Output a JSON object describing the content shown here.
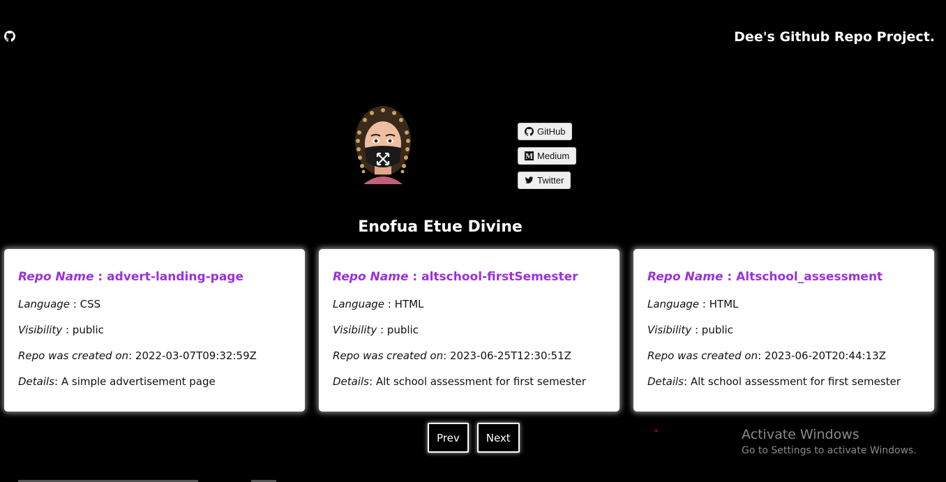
{
  "header": {
    "title": "Dee's Github Repo Project."
  },
  "social": [
    {
      "label": "GitHub",
      "icon": "github-icon"
    },
    {
      "label": "Medium",
      "icon": "medium-icon"
    },
    {
      "label": "Twitter",
      "icon": "twitter-icon"
    }
  ],
  "profile": {
    "name": "Enofua Etue Divine"
  },
  "labels": {
    "repo_name": "Repo Name",
    "language": "Language",
    "visibility": "Visibility",
    "created": "Repo was created on",
    "details": "Details"
  },
  "repos": [
    {
      "name": "advert-landing-page",
      "language": "CSS",
      "visibility": "public",
      "created": "2022-03-07T09:32:59Z",
      "details": "A simple advertisement page"
    },
    {
      "name": "altschool-firstSemester",
      "language": "HTML",
      "visibility": "public",
      "created": "2023-06-25T12:30:51Z",
      "details": "Alt school assessment for first semester"
    },
    {
      "name": "Altschool_assessment",
      "language": "HTML",
      "visibility": "public",
      "created": "2023-06-20T20:44:13Z",
      "details": "Alt school assessment for first semester"
    }
  ],
  "pagination": {
    "prev": "Prev",
    "next": "Next"
  },
  "watermark": {
    "title": "Activate Windows",
    "subtitle": "Go to Settings to activate Windows."
  },
  "colors": {
    "background": "#000000",
    "accent": "#9b30e0",
    "card": "#ffffff"
  }
}
